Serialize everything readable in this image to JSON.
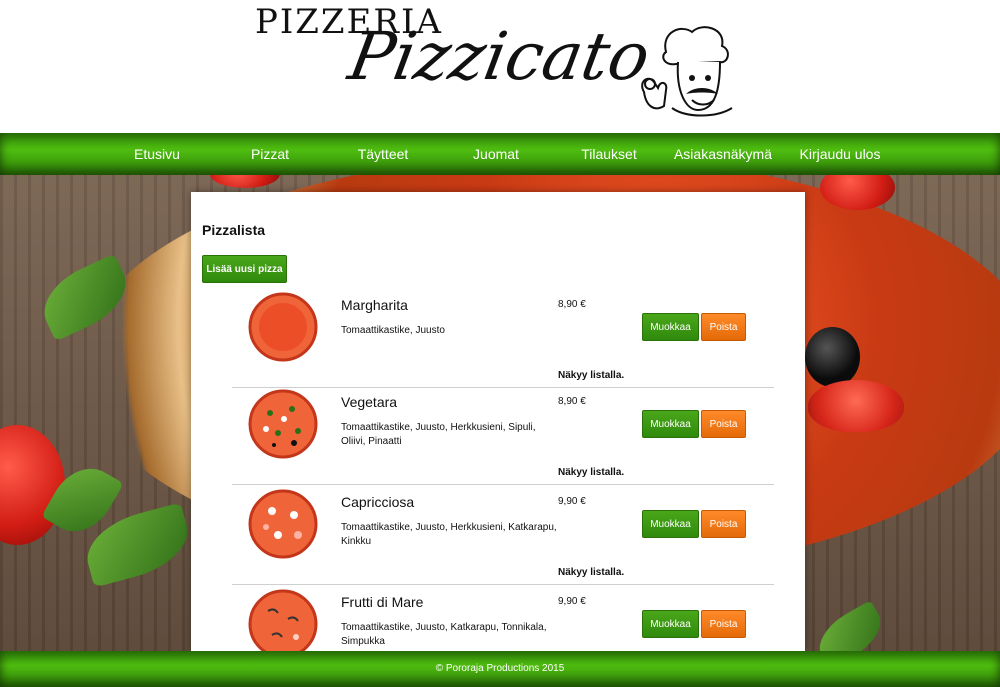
{
  "brand": {
    "line1": "PIZZERIA",
    "line2": "Pizzicato"
  },
  "nav": {
    "items": [
      {
        "label": "Etusivu"
      },
      {
        "label": "Pizzat"
      },
      {
        "label": "Täytteet"
      },
      {
        "label": "Juomat"
      },
      {
        "label": "Tilaukset"
      },
      {
        "label": "Asiakasnäkymä"
      },
      {
        "label": "Kirjaudu ulos"
      }
    ]
  },
  "main": {
    "title": "Pizzalista",
    "add_button": "Lisää uusi pizza",
    "edit_label": "Muokkaa",
    "delete_label": "Poista",
    "pizzas": [
      {
        "name": "Margharita",
        "toppings": "Tomaattikastike, Juusto",
        "price": "8,90 €",
        "status": "Näkyy listalla."
      },
      {
        "name": "Vegetara",
        "toppings": "Tomaattikastike, Juusto, Herkkusieni, Sipuli, Oliivi, Pinaatti",
        "price": "8,90 €",
        "status": "Näkyy listalla."
      },
      {
        "name": "Capricciosa",
        "toppings": "Tomaattikastike, Juusto, Herkkusieni, Katkarapu, Kinkku",
        "price": "9,90 €",
        "status": "Näkyy listalla."
      },
      {
        "name": "Frutti di Mare",
        "toppings": "Tomaattikastike, Juusto, Katkarapu, Tonnikala, Simpukka",
        "price": "9,90 €",
        "status": ""
      }
    ]
  },
  "footer": {
    "text": "© Pororaja Productions 2015"
  },
  "colors": {
    "nav_green": "#3e9f0c",
    "edit_green": "#2f8a0c",
    "delete_orange": "#e46a08"
  }
}
